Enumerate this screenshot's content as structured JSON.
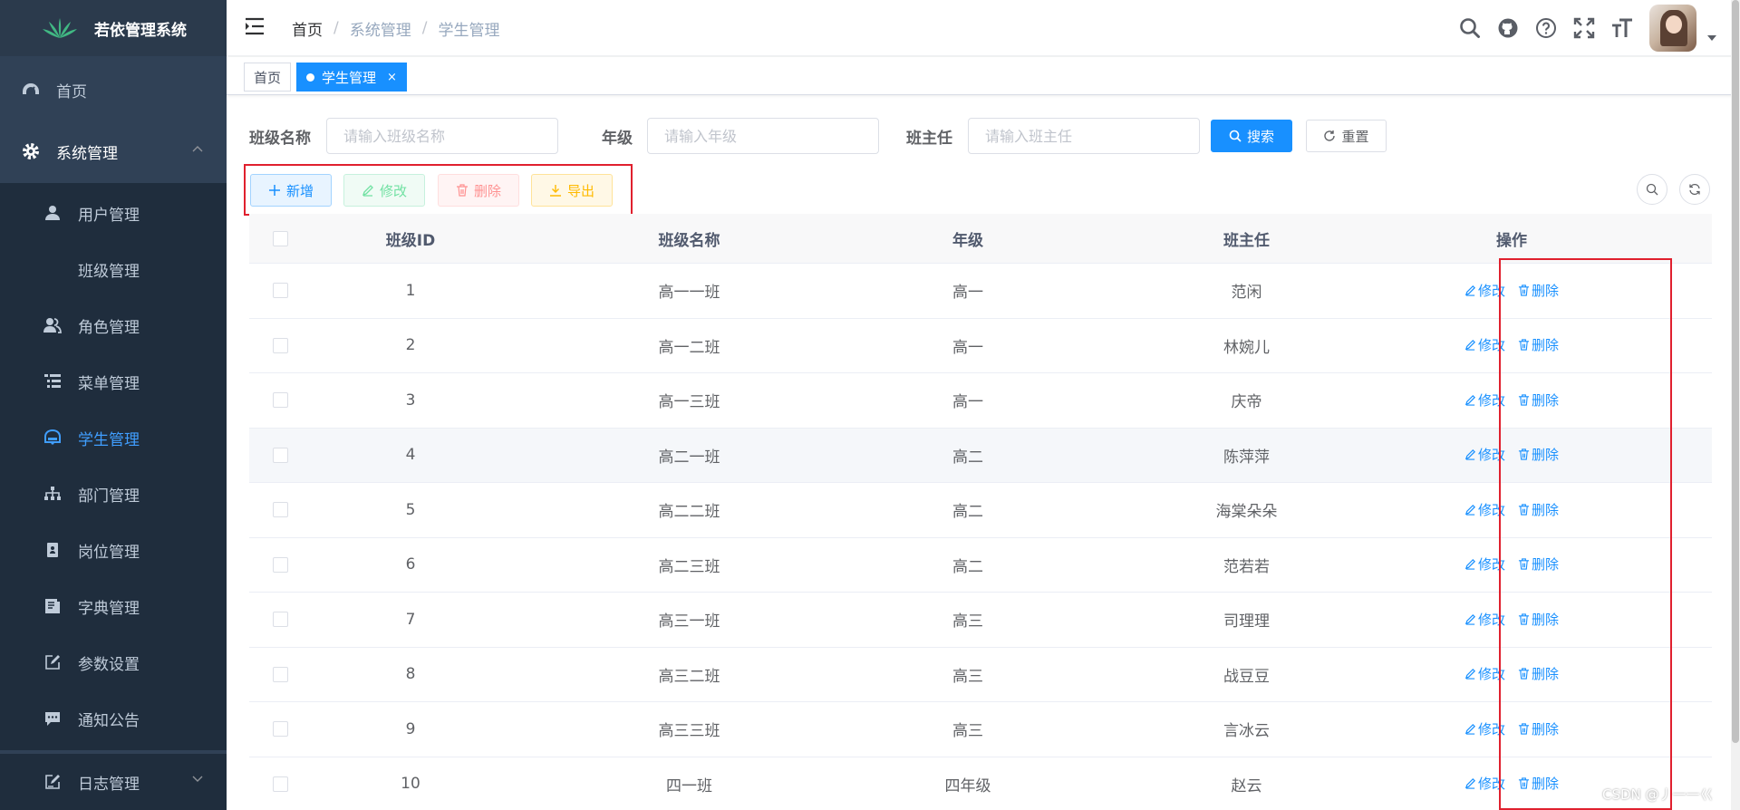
{
  "app": {
    "title": "若依管理系统"
  },
  "sidebar": {
    "items": [
      {
        "label": "首页",
        "icon": "dashboard-icon"
      },
      {
        "label": "系统管理",
        "icon": "gear-icon"
      },
      {
        "label": "用户管理",
        "icon": "user-icon"
      },
      {
        "label": "班级管理",
        "icon": ""
      },
      {
        "label": "角色管理",
        "icon": "peoples-icon"
      },
      {
        "label": "菜单管理",
        "icon": "tree-table-icon"
      },
      {
        "label": "学生管理",
        "icon": "student-icon"
      },
      {
        "label": "部门管理",
        "icon": "tree-icon"
      },
      {
        "label": "岗位管理",
        "icon": "post-icon"
      },
      {
        "label": "字典管理",
        "icon": "dict-icon"
      },
      {
        "label": "参数设置",
        "icon": "edit-icon"
      },
      {
        "label": "通知公告",
        "icon": "message-icon"
      },
      {
        "label": "日志管理",
        "icon": "log-icon"
      }
    ],
    "active_color": "#409eff"
  },
  "breadcrumb": [
    "首页",
    "系统管理",
    "学生管理"
  ],
  "tags": [
    {
      "label": "首页"
    },
    {
      "label": "学生管理",
      "close": "×"
    }
  ],
  "search": {
    "class_name_label": "班级名称",
    "class_name_placeholder": "请输入班级名称",
    "grade_label": "年级",
    "grade_placeholder": "请输入年级",
    "teacher_label": "班主任",
    "teacher_placeholder": "请输入班主任",
    "search_button": "搜索",
    "reset_button": "重置"
  },
  "toolbar": {
    "add": "新增",
    "edit": "修改",
    "delete": "删除",
    "export": "导出"
  },
  "table": {
    "headers": [
      "班级ID",
      "班级名称",
      "年级",
      "班主任",
      "操作"
    ],
    "rows": [
      {
        "id": "1",
        "name": "高一一班",
        "grade": "高一",
        "teacher": "范闲"
      },
      {
        "id": "2",
        "name": "高一二班",
        "grade": "高一",
        "teacher": "林婉儿"
      },
      {
        "id": "3",
        "name": "高一三班",
        "grade": "高一",
        "teacher": "庆帝"
      },
      {
        "id": "4",
        "name": "高二一班",
        "grade": "高二",
        "teacher": "陈萍萍"
      },
      {
        "id": "5",
        "name": "高二二班",
        "grade": "高二",
        "teacher": "海棠朵朵"
      },
      {
        "id": "6",
        "name": "高二三班",
        "grade": "高二",
        "teacher": "范若若"
      },
      {
        "id": "7",
        "name": "高三一班",
        "grade": "高三",
        "teacher": "司理理"
      },
      {
        "id": "8",
        "name": "高三二班",
        "grade": "高三",
        "teacher": "战豆豆"
      },
      {
        "id": "9",
        "name": "高三三班",
        "grade": "高三",
        "teacher": "言冰云"
      },
      {
        "id": "10",
        "name": "四一班",
        "grade": "四年级",
        "teacher": "赵云"
      }
    ],
    "row_actions": {
      "edit": "修改",
      "delete": "删除"
    }
  },
  "watermark": "CSDN @丿一一巜",
  "colors": {
    "primary": "#1890ff",
    "sidebar_bg": "#304156",
    "highlight_box": "#e0202e"
  }
}
